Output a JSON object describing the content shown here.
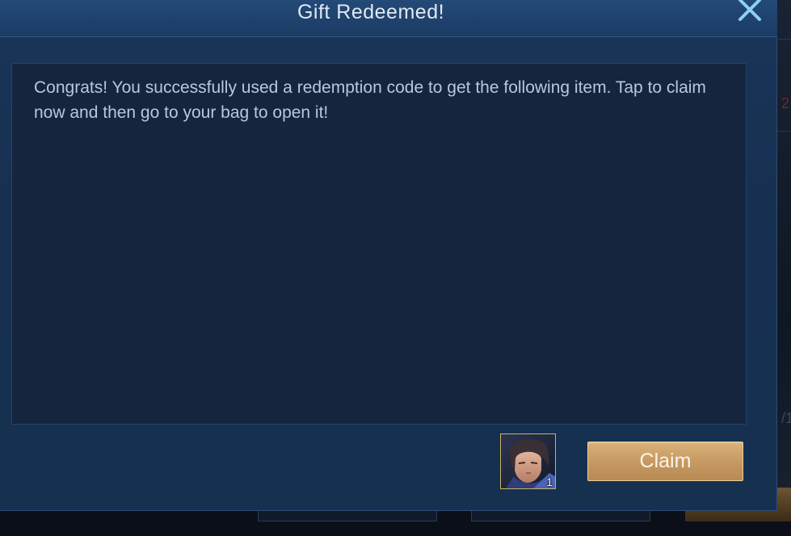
{
  "dialog": {
    "title": "Gift Redeemed!",
    "message": "Congrats! You successfully used a redemption code to get the following item. Tap to claim now and then go to your bag to open it!",
    "close_icon": "close-icon"
  },
  "reward": {
    "icon": "hero-portrait-icon",
    "quantity": "1"
  },
  "actions": {
    "claim_label": "Claim"
  },
  "colors": {
    "title_text": "#e2e8f2",
    "message_text": "#b9c6e2",
    "claim_button": "#c69a62",
    "close_icon": "#8fd0f5",
    "item_border": "#c8b267"
  }
}
